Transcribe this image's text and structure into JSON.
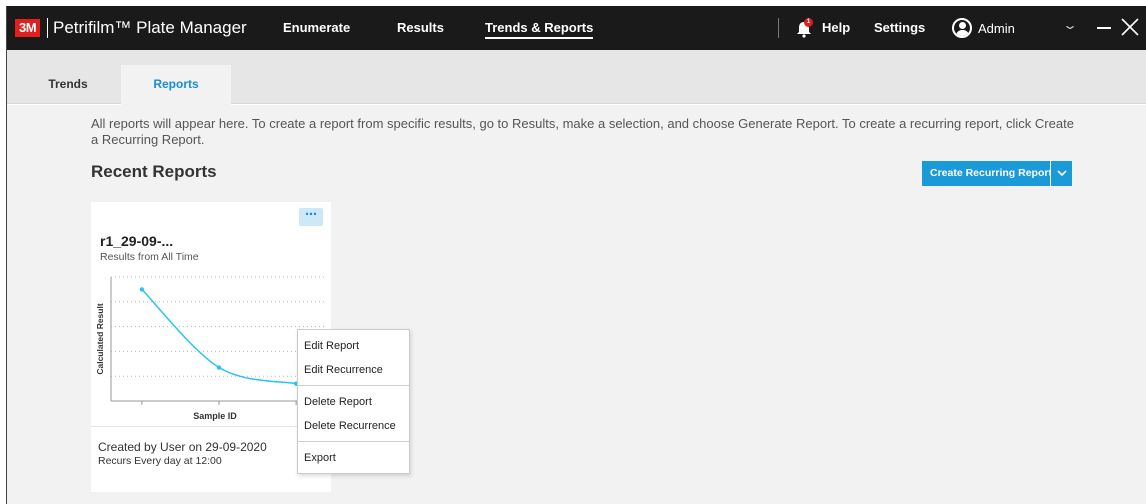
{
  "header": {
    "logo": "3M",
    "app_title": "Petrifilm™ Plate Manager",
    "nav": [
      {
        "label": "Enumerate"
      },
      {
        "label": "Results"
      },
      {
        "label": "Trends & Reports"
      }
    ],
    "notification_count": "1",
    "help": "Help",
    "settings": "Settings",
    "user": "Admin"
  },
  "tabs": [
    {
      "label": "Trends"
    },
    {
      "label": "Reports"
    }
  ],
  "main": {
    "intro": "All reports will appear here. To create a report from specific results, go to Results, make a selection, and choose Generate Report. To create a recurring report, click Create a Recurring Report.",
    "section_title": "Recent Reports",
    "create_button": "Create Recurring Report"
  },
  "card": {
    "title": "r1_29-09-...",
    "subtitle": "Results from All Time",
    "created": "Created by User on 29-09-2020",
    "recurs": "Recurs Every day at 12:00",
    "menu": {
      "groups": [
        [
          "Edit Report",
          "Edit Recurrence"
        ],
        [
          "Delete Report",
          "Delete Recurrence"
        ],
        [
          "Export"
        ]
      ]
    }
  },
  "chart_data": {
    "type": "line",
    "xlabel": "Sample ID",
    "ylabel": "Calculated Result",
    "line_color": "#2bc4f2",
    "points": [
      {
        "x": 1,
        "y": 0.9
      },
      {
        "x": 2,
        "y": 0.27
      },
      {
        "x": 3,
        "y": 0.14
      }
    ],
    "x_range": [
      0.6,
      3.4
    ],
    "y_range": [
      0,
      1
    ],
    "grid": true
  },
  "colors": {
    "accent": "#1a9ad6",
    "brand": "#e01e1e",
    "titlebar": "#1a1a1a"
  }
}
